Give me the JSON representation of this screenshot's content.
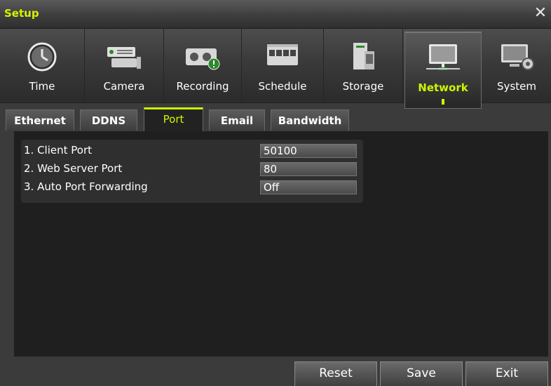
{
  "window": {
    "title": "Setup",
    "close_symbol": "✕"
  },
  "categories": [
    {
      "label": "Time",
      "icon": "clock-icon",
      "active": false
    },
    {
      "label": "Camera",
      "icon": "camera-icon",
      "active": false
    },
    {
      "label": "Recording",
      "icon": "recorder-icon",
      "active": false
    },
    {
      "label": "Schedule",
      "icon": "schedule-icon",
      "active": false
    },
    {
      "label": "Storage",
      "icon": "storage-icon",
      "active": false
    },
    {
      "label": "Network",
      "icon": "network-icon",
      "active": true
    },
    {
      "label": "System",
      "icon": "system-gear-icon",
      "active": false
    }
  ],
  "tabs": [
    {
      "label": "Ethernet",
      "active": false
    },
    {
      "label": "DDNS",
      "active": false
    },
    {
      "label": "Port",
      "active": true
    },
    {
      "label": "Email",
      "active": false
    },
    {
      "label": "Bandwidth",
      "active": false
    }
  ],
  "settings": [
    {
      "label": "1. Client Port",
      "value": "50100"
    },
    {
      "label": "2. Web Server Port",
      "value": "80"
    },
    {
      "label": "3. Auto Port Forwarding",
      "value": "Off"
    }
  ],
  "buttons": {
    "reset": "Reset",
    "save": "Save",
    "exit": "Exit"
  },
  "colors": {
    "accent": "#cff400",
    "background": "#3b3b3b",
    "panel": "#1f1f1f"
  }
}
